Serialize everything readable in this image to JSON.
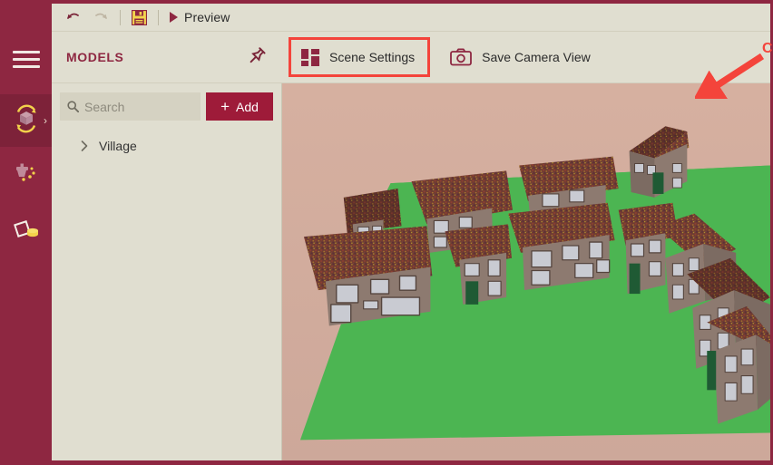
{
  "window": {
    "accent": "#8E2741",
    "panel_bg": "#E0DED0",
    "annotation_color": "#F4443B"
  },
  "rail": {
    "items": [
      {
        "name": "menu",
        "icon": "hamburger-menu-icon",
        "label": "Menu",
        "active": false
      },
      {
        "name": "models",
        "icon": "rotating-cube-icon",
        "label": "Models",
        "active": true
      },
      {
        "name": "resources",
        "icon": "faucet-coins-icon",
        "label": "Resources",
        "active": false
      },
      {
        "name": "assets",
        "icon": "diamond-coins-icon",
        "label": "Assets",
        "active": false
      }
    ]
  },
  "toolbar": {
    "undo_label": "Undo",
    "redo_label": "Redo",
    "save_label": "Save",
    "preview_label": "Preview"
  },
  "panel": {
    "title": "MODELS",
    "pin_label": "Pin panel",
    "search": {
      "value": "",
      "placeholder": "Search"
    },
    "add_label": "Add",
    "add_plus": "+",
    "tree": [
      {
        "label": "Village",
        "expanded": false
      }
    ]
  },
  "scene_bar": {
    "scene_settings_label": "Scene Settings",
    "save_camera_label": "Save Camera View"
  },
  "annotation": {
    "text": "Click Here",
    "target": "Scene Settings"
  },
  "viewport": {
    "sky_color": "#D2AC9D",
    "ground_color": "#4CB552",
    "wall_color": "#8D7A70",
    "roof_color": "#6E3B32",
    "window_color": "#C9CBD2",
    "door_color": "#1F5A34",
    "scene_name": "Village",
    "building_count": 10
  }
}
